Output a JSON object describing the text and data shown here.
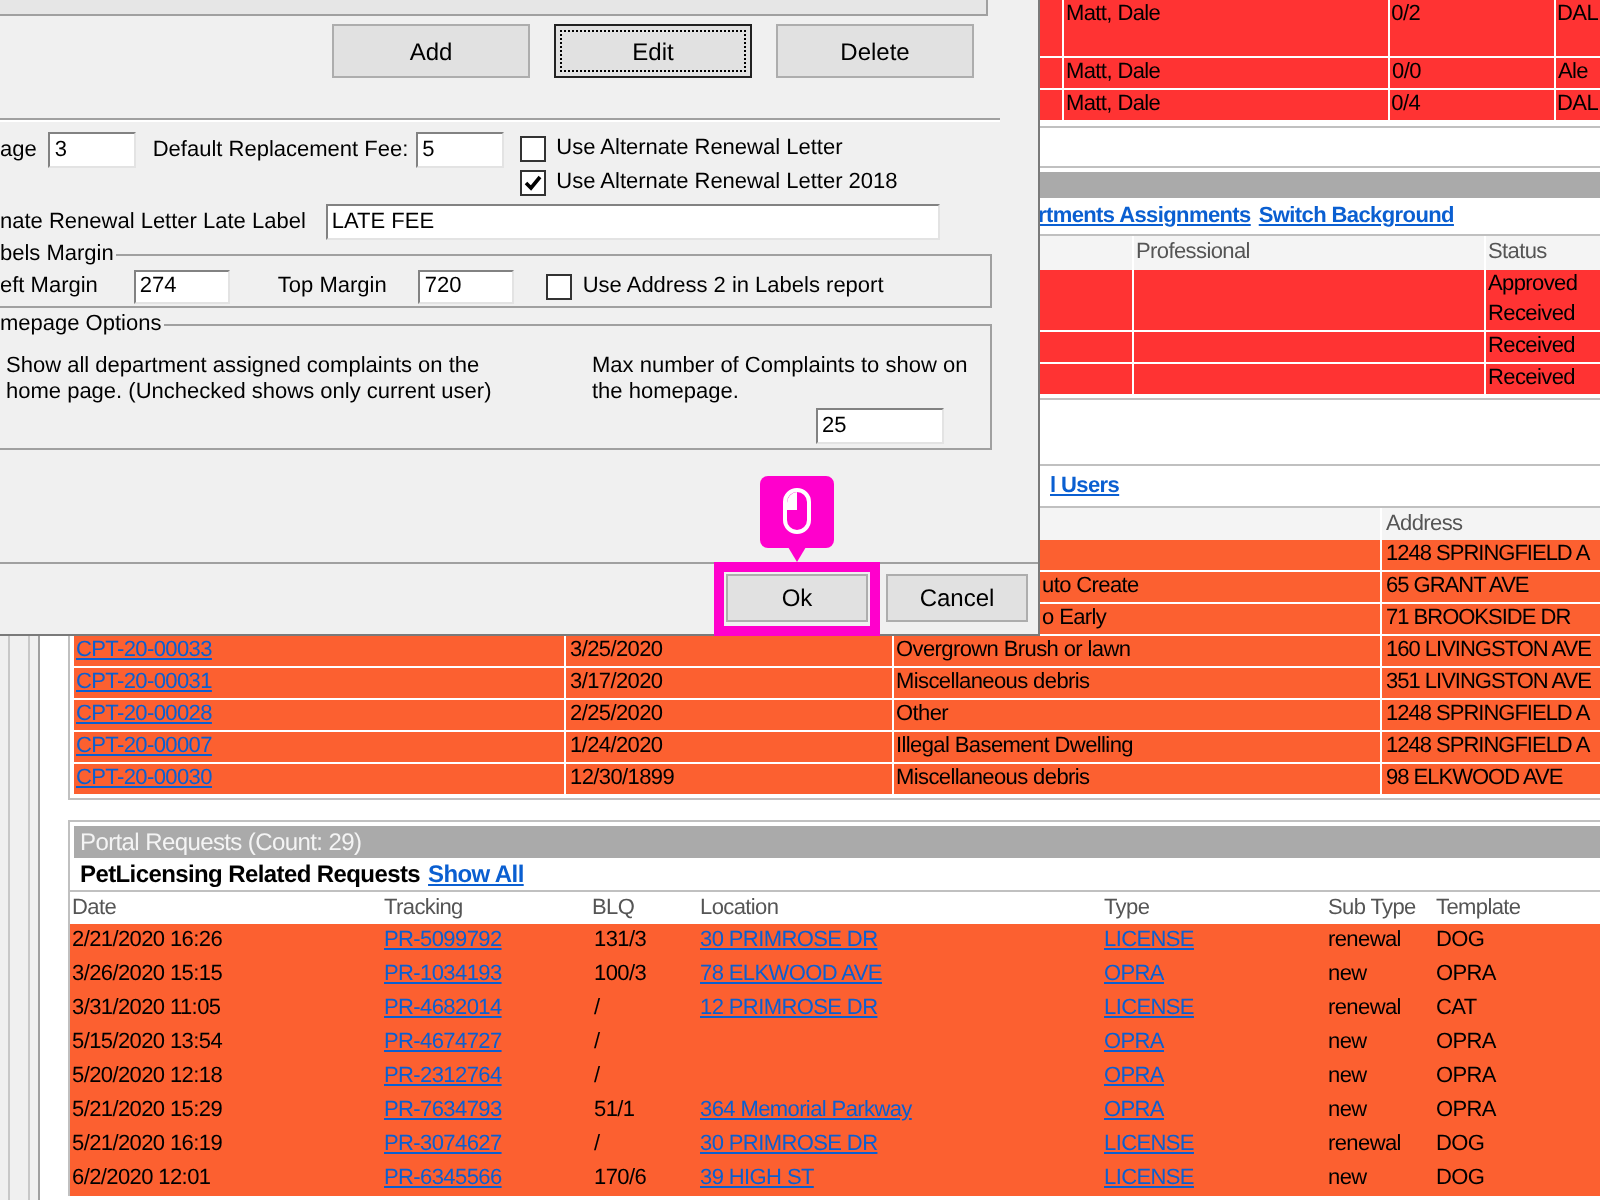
{
  "dialog": {
    "grid_buttons": [
      {
        "label": "Add",
        "focused": false
      },
      {
        "label": "Edit",
        "focused": true
      },
      {
        "label": "Delete",
        "focused": false
      }
    ],
    "fee_row": {
      "label": "age",
      "value": "3",
      "replacement_fee_label": "Default Replacement Fee:",
      "replacement_fee_value": "5"
    },
    "letter_options": [
      {
        "label": "Use Alternate Renewal Letter",
        "checked": false
      },
      {
        "label": "Use Alternate Renewal Letter 2018",
        "checked": true
      }
    ],
    "late_label": {
      "label": "nate Renewal Letter Late Label",
      "value": "LATE FEE"
    },
    "labels_margin": {
      "legend": "bels Margin",
      "left_label": "eft Margin",
      "left_value": "274",
      "top_label": "Top Margin",
      "top_value": "720",
      "address_option": {
        "label": "Use Address 2 in Labels report",
        "checked": false
      }
    },
    "homepage_options": {
      "legend": "mepage Options",
      "description": "Show all department assigned complaints on the home page. (Unchecked shows only current user)",
      "max_label": "Max number of Complaints to show on the homepage.",
      "max_value": "25"
    },
    "footer_buttons": [
      {
        "label": "Ok",
        "highlighted": true
      },
      {
        "label": "Cancel",
        "highlighted": false
      }
    ]
  },
  "assignments_table": {
    "rows": [
      {
        "cells": [
          "Matt, Dale",
          "0/2",
          "DAL"
        ]
      },
      {
        "cells": [
          "Matt, Dale",
          "0/0",
          "Ale"
        ]
      },
      {
        "cells": [
          "Matt, Dale",
          "0/4",
          "DAL"
        ]
      }
    ]
  },
  "status_table": {
    "links": [
      "rtments Assignments",
      "Switch Background"
    ],
    "columns": [
      "Professional",
      "Status"
    ],
    "rows": [
      {
        "status": "Approved Received"
      },
      {
        "status": "Received"
      },
      {
        "status": "Received"
      }
    ]
  },
  "users_table": {
    "link": "l Users",
    "columns": [
      "Address"
    ],
    "rows": [
      {
        "address": "1248 SPRINGFIELD A"
      },
      {
        "description": "uto Create",
        "address": "65 GRANT AVE"
      },
      {
        "description": "o Early",
        "address": "71 BROOKSIDE DR"
      },
      {
        "id": "CPT-20-00033",
        "date": "3/25/2020",
        "description": "Overgrown Brush or lawn",
        "address": "160 LIVINGSTON AVE"
      },
      {
        "id": "CPT-20-00031",
        "date": "3/17/2020",
        "description": "Miscellaneous debris",
        "address": "351 LIVINGSTON AVE"
      },
      {
        "id": "CPT-20-00028",
        "date": "2/25/2020",
        "description": "Other",
        "address": "1248 SPRINGFIELD A"
      },
      {
        "id": "CPT-20-00007",
        "date": "1/24/2020",
        "description": "Illegal Basement Dwelling",
        "address": "1248 SPRINGFIELD A"
      },
      {
        "id": "CPT-20-00030",
        "date": "12/30/1899",
        "description": "Miscellaneous debris",
        "address": "98 ELKWOOD AVE"
      }
    ]
  },
  "portal_requests": {
    "title": "Portal Requests (Count: 29)",
    "subtitle": "PetLicensing Related Requests",
    "show_all": "Show All",
    "columns": [
      "Date",
      "Tracking",
      "BLQ",
      "Location",
      "Type",
      "Sub Type",
      "Template"
    ],
    "rows": [
      {
        "date": "2/21/2020 16:26",
        "tracking": "PR-5099792",
        "blq": "131/3",
        "location": "30 PRIMROSE DR",
        "type": "LICENSE",
        "sub_type": "renewal",
        "template": "DOG"
      },
      {
        "date": "3/26/2020 15:15",
        "tracking": "PR-1034193",
        "blq": "100/3",
        "location": "78 ELKWOOD AVE",
        "type": "OPRA",
        "sub_type": "new",
        "template": "OPRA"
      },
      {
        "date": "3/31/2020 11:05",
        "tracking": "PR-4682014",
        "blq": "/",
        "location": "12 PRIMROSE DR",
        "type": "LICENSE",
        "sub_type": "renewal",
        "template": "CAT"
      },
      {
        "date": "5/15/2020 13:54",
        "tracking": "PR-4674727",
        "blq": "/",
        "type": "OPRA",
        "sub_type": "new",
        "template": "OPRA"
      },
      {
        "date": "5/20/2020 12:18",
        "tracking": "PR-2312764",
        "blq": "/",
        "type": "OPRA",
        "sub_type": "new",
        "template": "OPRA"
      },
      {
        "date": "5/21/2020 15:29",
        "tracking": "PR-7634793",
        "blq": "51/1",
        "location": "364 Memorial Parkway",
        "type": "OPRA",
        "sub_type": "new",
        "template": "OPRA"
      },
      {
        "date": "5/21/2020 16:19",
        "tracking": "PR-3074627",
        "blq": "/",
        "location": "30 PRIMROSE DR",
        "type": "LICENSE",
        "sub_type": "renewal",
        "template": "DOG"
      },
      {
        "date": "6/2/2020 12:01",
        "tracking": "PR-6345566",
        "blq": "170/6",
        "location": "39 HIGH ST",
        "type": "LICENSE",
        "sub_type": "new",
        "template": "DOG"
      }
    ]
  }
}
